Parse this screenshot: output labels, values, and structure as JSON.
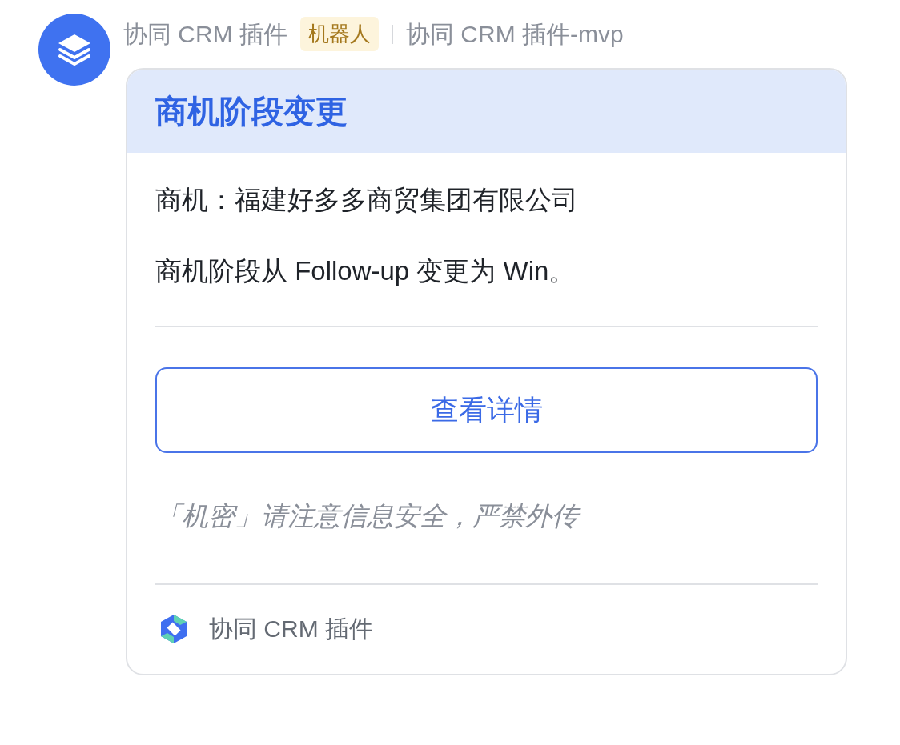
{
  "sender": {
    "name": "协同 CRM 插件",
    "tag": "机器人",
    "app": "协同 CRM 插件-mvp"
  },
  "card": {
    "title": "商机阶段变更",
    "lines": [
      "商机：福建好多多商贸集团有限公司",
      "商机阶段从 Follow-up 变更为 Win。"
    ],
    "button": "查看详情",
    "notice": "「机密」请注意信息安全，严禁外传",
    "footer": "协同 CRM 插件"
  }
}
